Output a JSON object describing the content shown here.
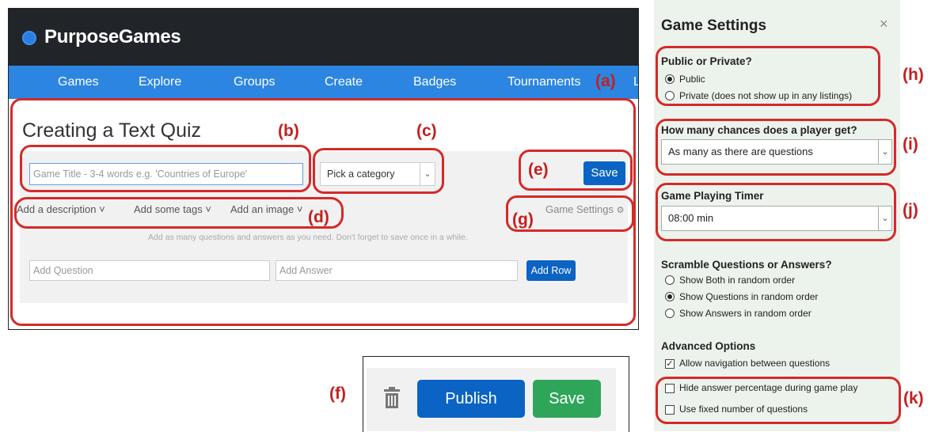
{
  "app": {
    "logo_text": "PurposeGames",
    "nav": [
      "Games",
      "Explore",
      "Groups",
      "Create",
      "Badges",
      "Tournaments",
      "L"
    ]
  },
  "page": {
    "title": "Creating a Text Quiz",
    "title_input_placeholder": "Game Title - 3-4 words e.g. 'Countries of Europe'",
    "category_select": "Pick a category",
    "save_label": "Save",
    "add_description": "Add a description",
    "add_tags": "Add some tags",
    "add_image": "Add an image",
    "game_settings": "Game Settings",
    "hint": "Add as many questions and answers as you need. Don't forget to save once in a while.",
    "question_placeholder": "Add Question",
    "answer_placeholder": "Add Answer",
    "add_row": "Add Row"
  },
  "publish_bar": {
    "publish_label": "Publish",
    "save_label": "Save"
  },
  "settings": {
    "title": "Game Settings",
    "close": "×",
    "visibility_heading": "Public or Private?",
    "visibility_options": [
      "Public",
      "Private (does not show up in any listings)"
    ],
    "visibility_selected": "Public",
    "chances_heading": "How many chances does a player get?",
    "chances_value": "As many as there are questions",
    "timer_heading": "Game Playing Timer",
    "timer_value": "08:00 min",
    "scramble_heading": "Scramble Questions or Answers?",
    "scramble_options": [
      "Show Both in random order",
      "Show Questions in random order",
      "Show Answers in random order"
    ],
    "scramble_selected": "Show Questions in random order",
    "advanced_heading": "Advanced Options",
    "advanced_options": [
      {
        "label": "Allow navigation between questions",
        "checked": true
      },
      {
        "label": "Hide answer percentage during game play",
        "checked": false
      },
      {
        "label": "Use fixed number of questions",
        "checked": false
      }
    ]
  },
  "annotations": {
    "a": "(a)",
    "b": "(b)",
    "c": "(c)",
    "d": "(d)",
    "e": "(e)",
    "f": "(f)",
    "g": "(g)",
    "h": "(h)",
    "i": "(i)",
    "j": "(j)",
    "k": "(k)"
  },
  "colors": {
    "topbar": "#212529",
    "navbar": "#2c85e0",
    "primary_button": "#0b63c4",
    "success_button": "#2fa559",
    "annotation_red": "#d42a2a",
    "settings_bg": "#ecf3ec"
  }
}
